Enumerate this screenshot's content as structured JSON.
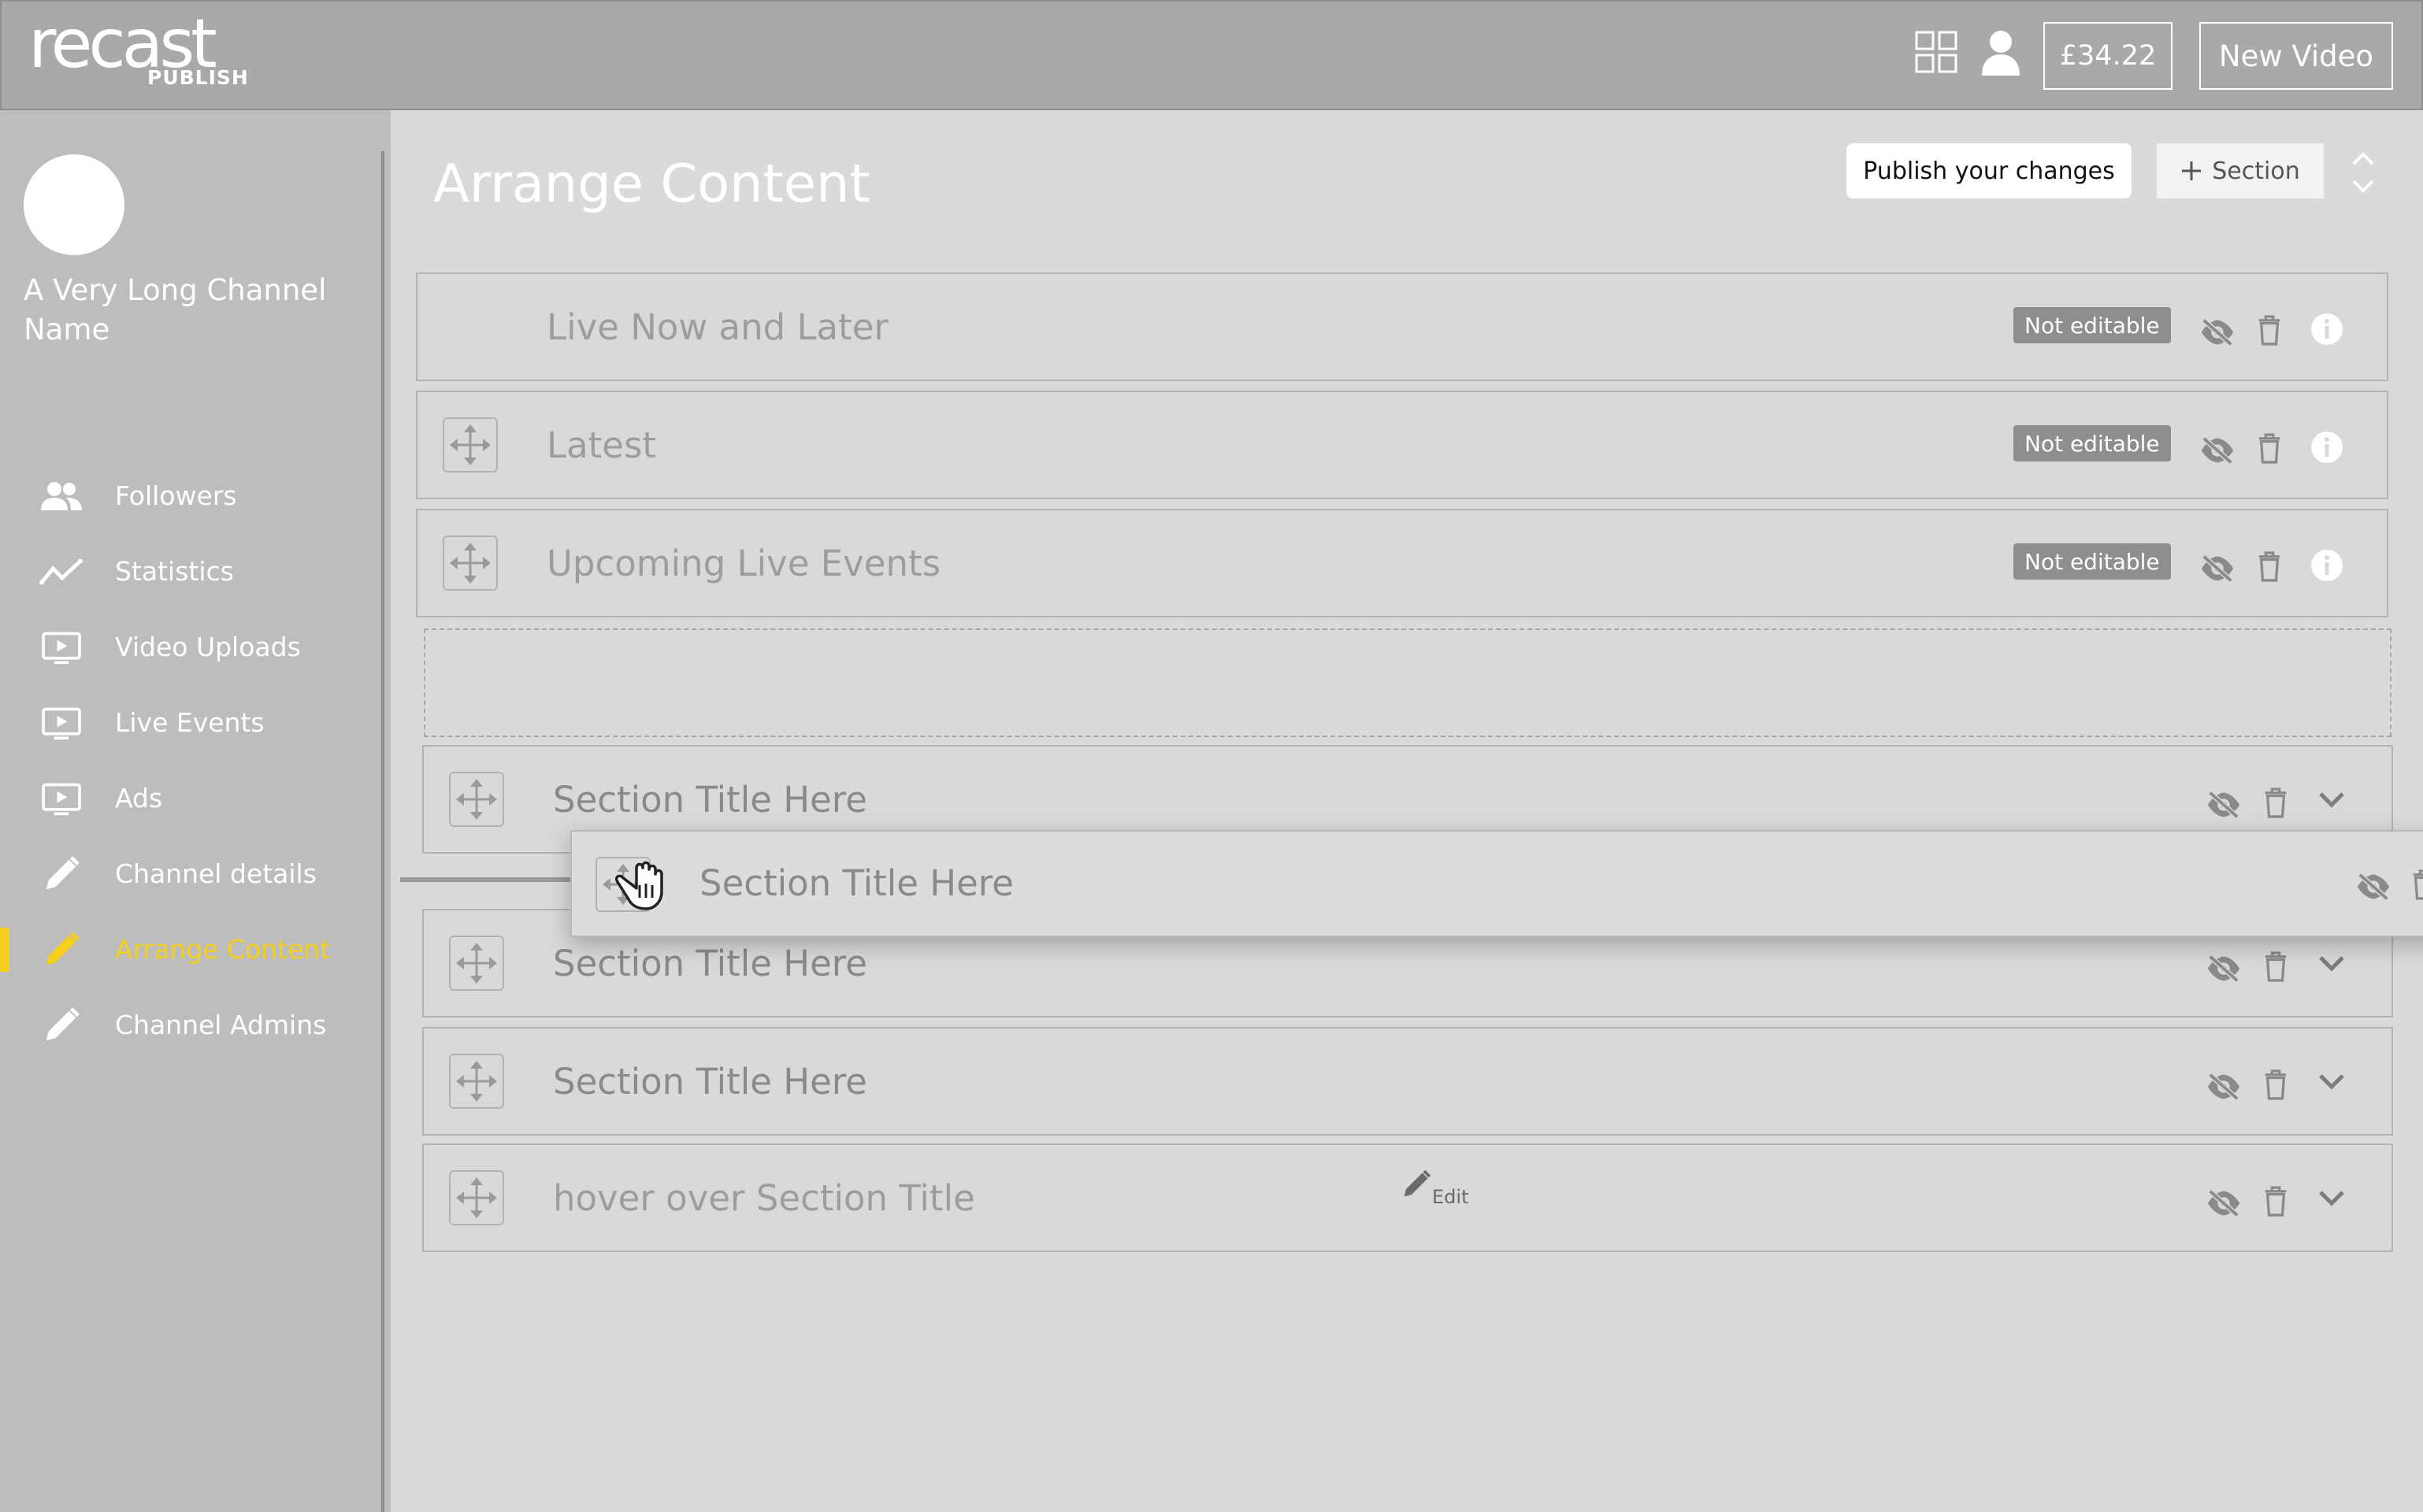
{
  "header": {
    "logo_main": "recast",
    "logo_sub": "PUBLISH",
    "balance": "£34.22",
    "new_video_label": "New Video",
    "icons": [
      "grid-icon",
      "user-icon"
    ]
  },
  "sidebar": {
    "channel_name": "A Very Long Channel Name",
    "items": [
      {
        "label": "Followers",
        "icon": "people-icon"
      },
      {
        "label": "Statistics",
        "icon": "chart-line-icon"
      },
      {
        "label": "Video Uploads",
        "icon": "video-icon"
      },
      {
        "label": "Live Events",
        "icon": "video-icon"
      },
      {
        "label": "Ads",
        "icon": "video-icon"
      },
      {
        "label": "Channel details",
        "icon": "pencil-icon"
      },
      {
        "label": "Arrange Content",
        "icon": "pencil-icon",
        "active": true
      },
      {
        "label": "Channel Admins",
        "icon": "pencil-icon"
      }
    ],
    "active_color": "#f5cf1a"
  },
  "main": {
    "title": "Arrange Content",
    "publish_label": "Publish your changes",
    "add_section_label": "Section",
    "sections": [
      {
        "title": "Live Now and Later",
        "badge": "Not editable",
        "movable": false
      },
      {
        "title": "Latest",
        "badge": "Not editable",
        "movable": true
      },
      {
        "title": "Upcoming Live Events",
        "badge": "Not editable",
        "movable": true
      },
      {
        "title": "Section Title Here"
      },
      {
        "title": "Section Title Here",
        "dragging": true
      },
      {
        "title": "Section Title Here"
      },
      {
        "title": "Section Title Here"
      },
      {
        "title": "hover over Section Title",
        "edit_label": "Edit"
      }
    ]
  }
}
